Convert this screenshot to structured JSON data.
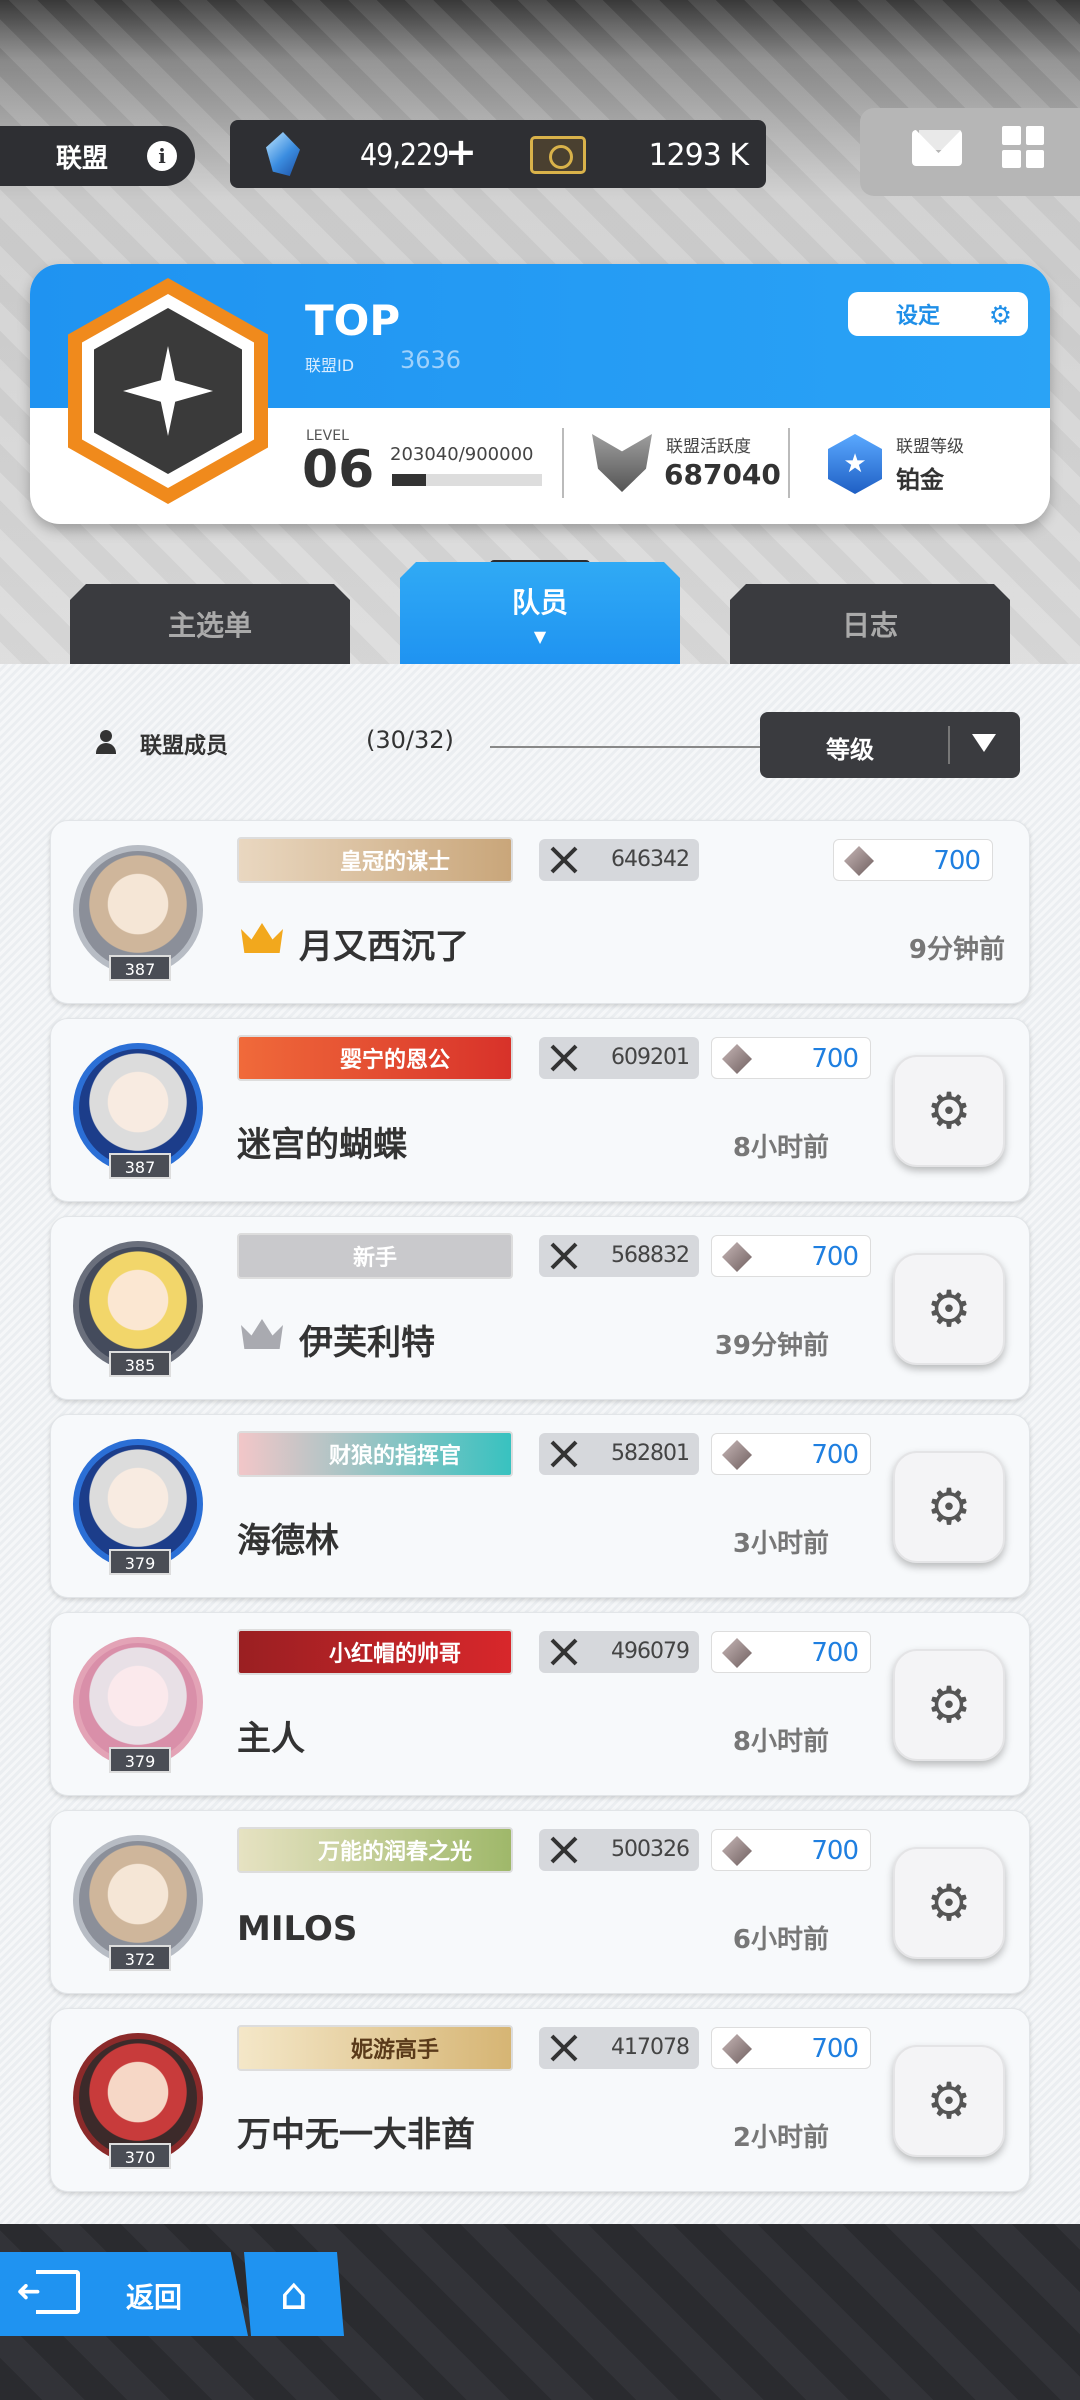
{
  "topbar": {
    "alliance_label": "联盟",
    "info_icon": "info-icon",
    "gems": "49,229",
    "gems_add": "+",
    "tickets": "1293 K",
    "mail_icon": "mail-icon",
    "menu_icon": "grid-menu-icon"
  },
  "alliance": {
    "name": "TOP",
    "id_label": "联盟ID",
    "id": "3636",
    "settings_label": "设定",
    "level_label": "LEVEL",
    "level": "06",
    "exp": "203040/900000",
    "exp_fraction": 0.2256,
    "activity_label": "联盟活跃度",
    "activity_value": "687040",
    "rank_label": "联盟等级",
    "rank_value": "铂金"
  },
  "tabs": [
    {
      "label": "主选单",
      "active": false
    },
    {
      "label": "队员",
      "active": true
    },
    {
      "label": "日志",
      "active": false
    }
  ],
  "members_header": {
    "label": "联盟成员",
    "count": "(30/32)",
    "sort_value": "等级"
  },
  "members": [
    {
      "level": "387",
      "title": "皇冠的谋士",
      "power": "646342",
      "contrib": "700",
      "name": "月又西沉了",
      "last_seen": "9分钟前",
      "crown": "gold",
      "has_gear": false
    },
    {
      "level": "387",
      "title": "婴宁的恩公",
      "power": "609201",
      "contrib": "700",
      "name": "迷宫的蝴蝶",
      "last_seen": "8小时前",
      "crown": "",
      "has_gear": true
    },
    {
      "level": "385",
      "title": "新手",
      "power": "568832",
      "contrib": "700",
      "name": "伊芙利特",
      "last_seen": "39分钟前",
      "crown": "grey",
      "has_gear": true
    },
    {
      "level": "379",
      "title": "财狼的指挥官",
      "power": "582801",
      "contrib": "700",
      "name": "海德林",
      "last_seen": "3小时前",
      "crown": "",
      "has_gear": true
    },
    {
      "level": "379",
      "title": "小红帽的帅哥",
      "power": "496079",
      "contrib": "700",
      "name": "主人",
      "last_seen": "8小时前",
      "crown": "",
      "has_gear": true
    },
    {
      "level": "372",
      "title": "万能的润春之光",
      "power": "500326",
      "contrib": "700",
      "name": "MILOS",
      "last_seen": "6小时前",
      "crown": "",
      "has_gear": true
    },
    {
      "level": "370",
      "title": "妮游高手",
      "power": "417078",
      "contrib": "700",
      "name": "万中无一大非酋",
      "last_seen": "2小时前",
      "crown": "",
      "has_gear": true
    }
  ],
  "bottom": {
    "back_label": "返回",
    "home_icon": "home-icon"
  },
  "colors": {
    "accent_blue": "#1f93f1",
    "dark": "#2e2f33",
    "emblem_orange": "#f08a1c"
  }
}
